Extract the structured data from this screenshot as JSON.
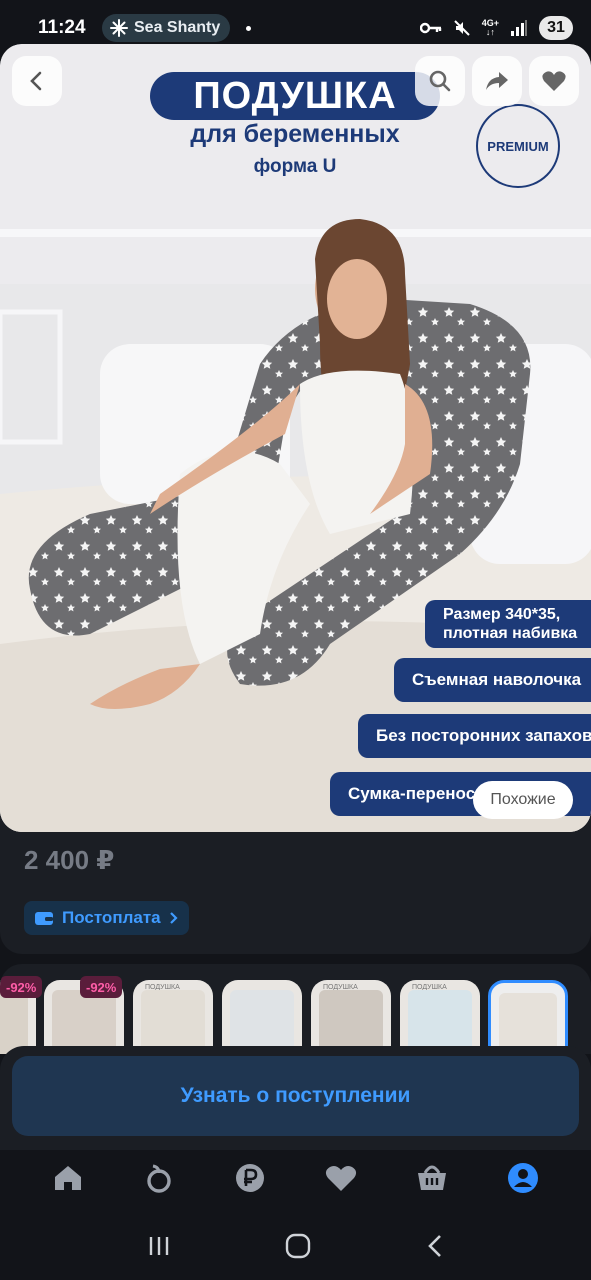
{
  "status": {
    "time": "11:24",
    "media": "Sea Shanty",
    "network": "4G+",
    "battery": "31"
  },
  "hero": {
    "title": "ПОДУШКА",
    "subtitle": "для беременных",
    "subtitle2": "форма U",
    "badge": "PREMIUM",
    "features": [
      {
        "line1": "Размер 340*35,",
        "line2": "плотная набивка"
      },
      {
        "line1": "Съемная наволочка"
      },
      {
        "line1": "Без посторонних запахов"
      },
      {
        "line1": "Сумка-перенос"
      }
    ],
    "similar_label": "Похожие"
  },
  "product": {
    "price": "2 400 ₽",
    "postpay_label": "Постоплата"
  },
  "thumbnails": {
    "discounts": [
      "-92%",
      "-92%"
    ],
    "labels": [
      "ПОДУШКА",
      "ПОДУШКА",
      "ПОДУШКА"
    ]
  },
  "actions": {
    "notify_label": "Узнать о поступлении"
  },
  "colors": {
    "accent": "#3f9bff",
    "brand_navy": "#1d3a78",
    "discount": "#ff5da8"
  },
  "icons": {
    "tabs": [
      "home-icon",
      "catalog-icon",
      "ruble-icon",
      "heart-icon",
      "basket-icon",
      "profile-icon"
    ],
    "active_tab": "profile-icon"
  }
}
